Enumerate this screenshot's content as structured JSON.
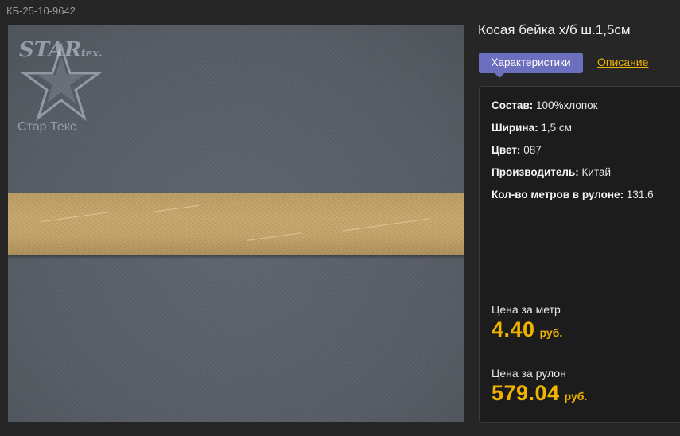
{
  "product": {
    "sku": "КБ-25-10-9642",
    "title": "Косая бейка х/б ш.1,5см"
  },
  "logo": {
    "wordmark": "STAR",
    "suffix": "tex.",
    "caption": "Стар Текс"
  },
  "tabs": {
    "characteristics": "Характеристики",
    "description": "Описание"
  },
  "specs": [
    {
      "label": "Состав:",
      "value": "100%хлопок"
    },
    {
      "label": "Ширина:",
      "value": "1,5 см"
    },
    {
      "label": "Цвет:",
      "value": "087"
    },
    {
      "label": "Производитель:",
      "value": "Китай"
    },
    {
      "label": "Кол-во метров в рулоне:",
      "value": "131.6"
    }
  ],
  "prices": {
    "per_meter_label": "Цена за метр",
    "per_meter_value": "4.40",
    "per_roll_label": "Цена за рулон",
    "per_roll_value": "579.04",
    "currency": "руб."
  },
  "colors": {
    "accent": "#f0b400",
    "tab_active": "#6c6fbe",
    "background": "#262626",
    "panel": "#1c1c1c"
  }
}
